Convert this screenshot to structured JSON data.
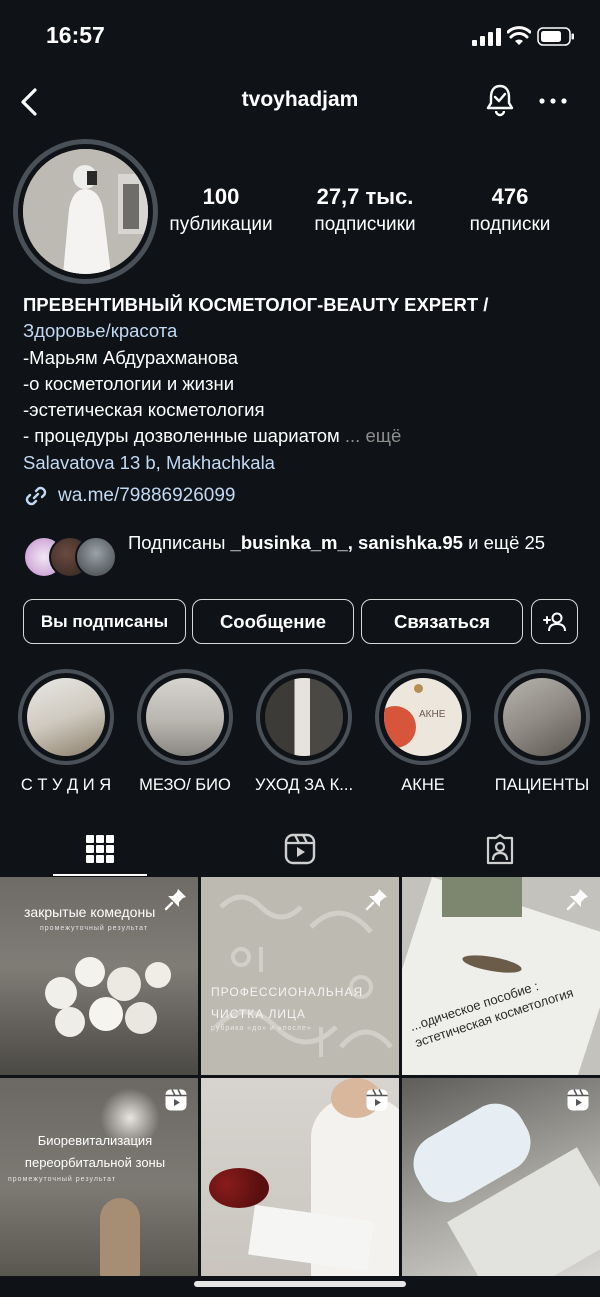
{
  "status_bar": {
    "time": "16:57"
  },
  "header": {
    "username": "tvoyhadjam"
  },
  "stats": {
    "posts": {
      "value": "100",
      "label": "публикации"
    },
    "followers": {
      "value": "27,7 тыс.",
      "label": "подписчики"
    },
    "following": {
      "value": "476",
      "label": "подписки"
    }
  },
  "bio": {
    "name": "ПРЕВЕНТИВНЫЙ КОСМЕТОЛОГ-BEAUTY EXPERT /",
    "category": "Здоровье/красота",
    "lines": [
      "-Марьям Абдурахманова",
      "-о косметологии и жизни",
      "-эстетическая косметология",
      "- процедуры дозволенные шариатом"
    ],
    "more": "... ещё",
    "location": "Salavatova 13 b, Makhachkala",
    "link": "wa.me/79886926099"
  },
  "followed_by": {
    "prefix": "Подписаны ",
    "user1": "_businka_m_",
    "separator": ", ",
    "user2": "sanishka.95",
    "suffix": " и ещё 25"
  },
  "buttons": {
    "following": "Вы подписаны",
    "message": "Сообщение",
    "contact": "Связаться"
  },
  "highlights": [
    {
      "label": "С Т У Д И Я"
    },
    {
      "label": "МЕЗО/ БИО"
    },
    {
      "label": "УХОД ЗА К..."
    },
    {
      "label": "АКНЕ",
      "image_text": "АКНЕ"
    },
    {
      "label": "ПАЦИЕНТЫ"
    }
  ],
  "posts": [
    {
      "title": "закрытые комедоны",
      "subtitle": "промежуточный результат",
      "icon": "pin-icon"
    },
    {
      "title": "ПРОФЕССИОНАЛЬНАЯ ЧИСТКА ЛИЦА",
      "subtitle": "рубрика «до» и «после»",
      "icon": "pin-icon"
    },
    {
      "title": "...одическое пособие : эстетическая косметология",
      "icon": "pin-icon"
    },
    {
      "title": "Биоревитализация переорбитальной зоны",
      "subtitle": "промежуточный результат",
      "icon": "reel-icon"
    },
    {
      "icon": "reel-icon"
    },
    {
      "icon": "reel-icon"
    }
  ],
  "colors": {
    "background": "#0f1318",
    "link": "#c3d8f2",
    "muted": "#8e8e8e",
    "ring": "#4a5057"
  }
}
